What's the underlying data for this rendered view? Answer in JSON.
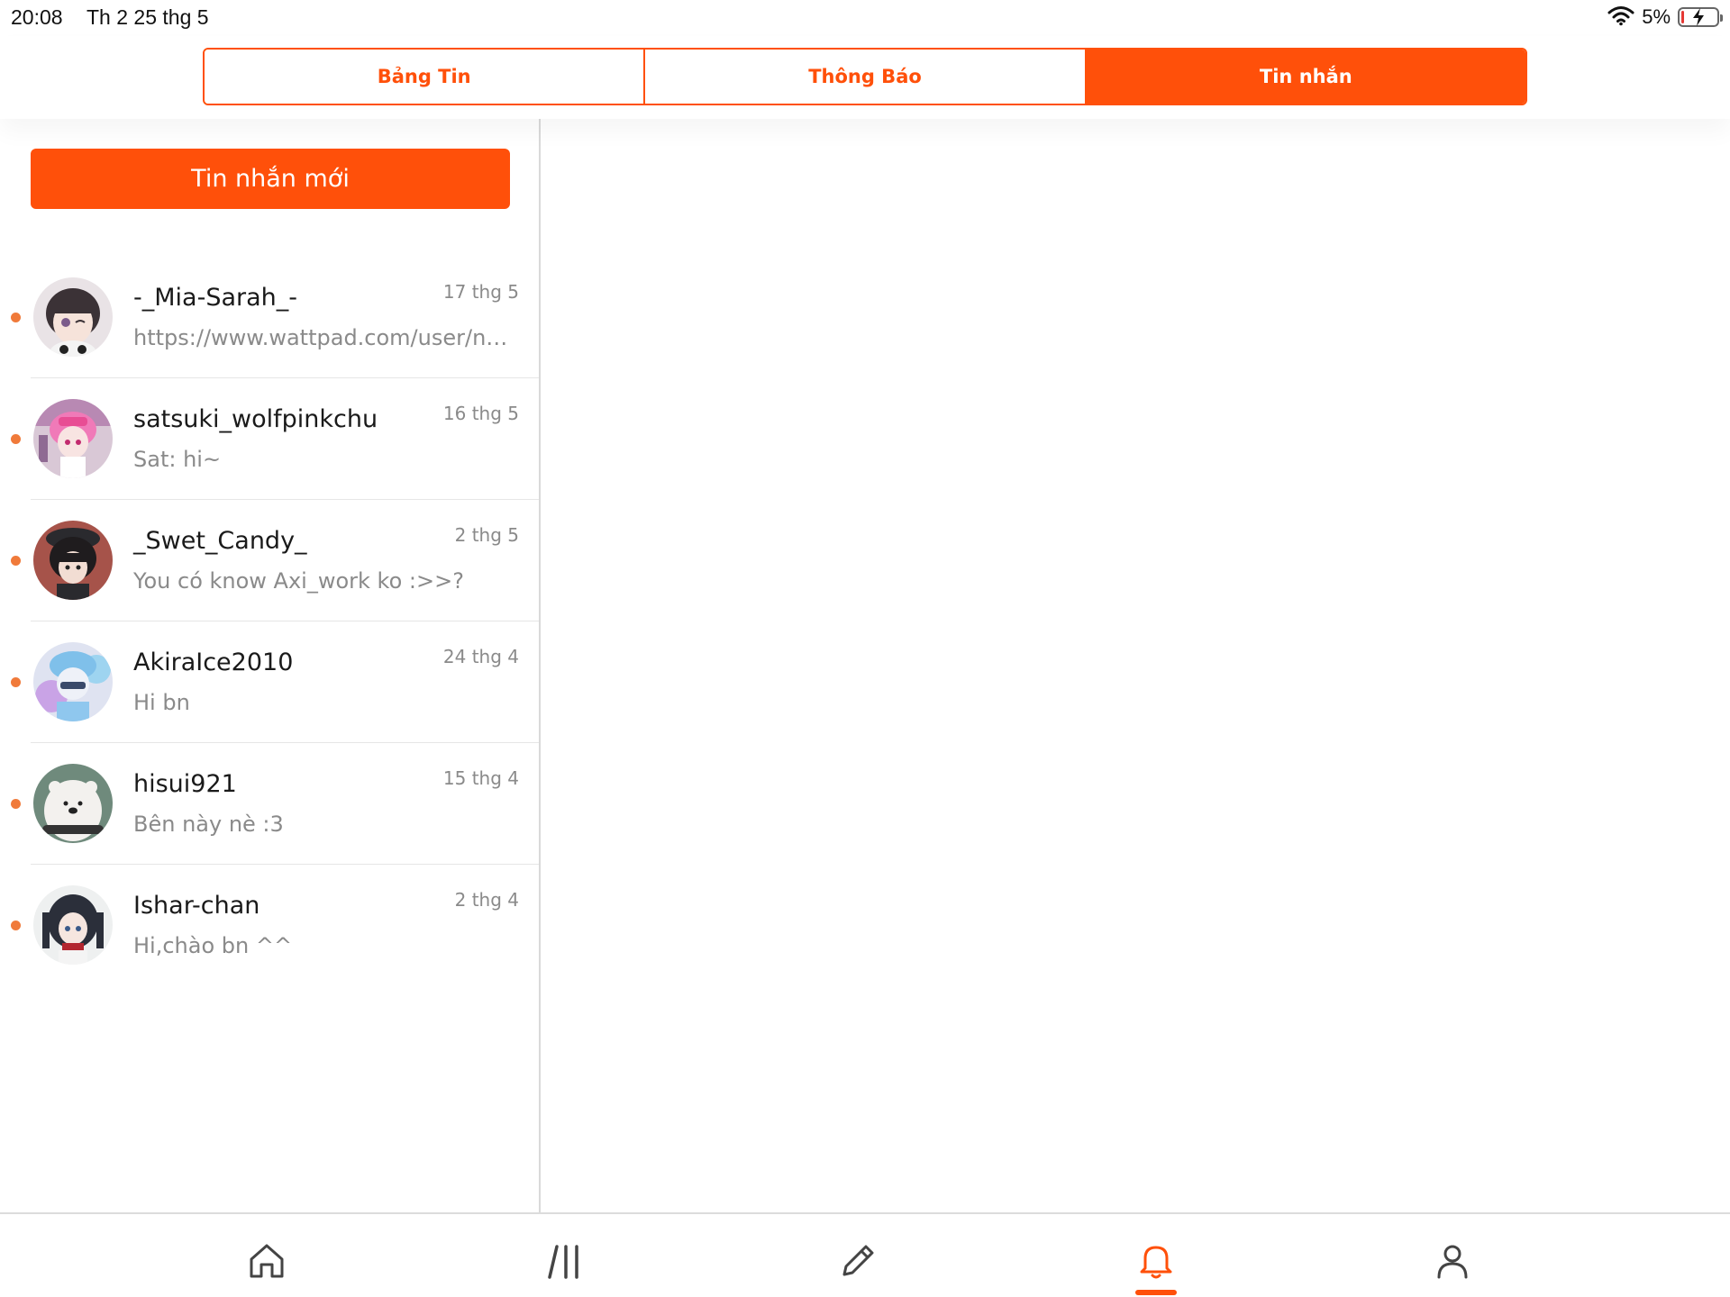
{
  "status_bar": {
    "time": "20:08",
    "date": "Th 2 25 thg 5",
    "battery": "5%",
    "battery_level": 0.05
  },
  "tabs": [
    {
      "label": "Bảng Tin",
      "active": false
    },
    {
      "label": "Thông Báo",
      "active": false
    },
    {
      "label": "Tin nhắn",
      "active": true
    }
  ],
  "new_message_label": "Tin nhắn mới",
  "conversations": [
    {
      "name": "-_Mia-Sarah_-",
      "date": "17 thg 5",
      "preview": "https://www.wattpad.com/user/nhockpeanut",
      "unread": true
    },
    {
      "name": "satsuki_wolfpinkchu",
      "date": "16 thg 5",
      "preview": "Sat: hi~",
      "unread": true
    },
    {
      "name": "_Swet_Candy_",
      "date": "2 thg 5",
      "preview": "You có know Axi_work ko :>>?",
      "unread": true
    },
    {
      "name": "AkiraIce2010",
      "date": "24 thg 4",
      "preview": "Hi bn",
      "unread": true
    },
    {
      "name": "hisui921",
      "date": "15 thg 4",
      "preview": "Bên này nè :3",
      "unread": true
    },
    {
      "name": "Ishar-chan",
      "date": "2 thg 4",
      "preview": "Hi,chào bn ^^",
      "unread": true
    }
  ],
  "bottom_nav": [
    {
      "icon": "home-icon",
      "active": false
    },
    {
      "icon": "library-icon",
      "active": false
    },
    {
      "icon": "pencil-icon",
      "active": false
    },
    {
      "icon": "bell-icon",
      "active": true
    },
    {
      "icon": "profile-icon",
      "active": false
    }
  ],
  "colors": {
    "accent": "#ff500a",
    "unread_dot": "#f07a3a",
    "muted_text": "#8a8a8a"
  }
}
